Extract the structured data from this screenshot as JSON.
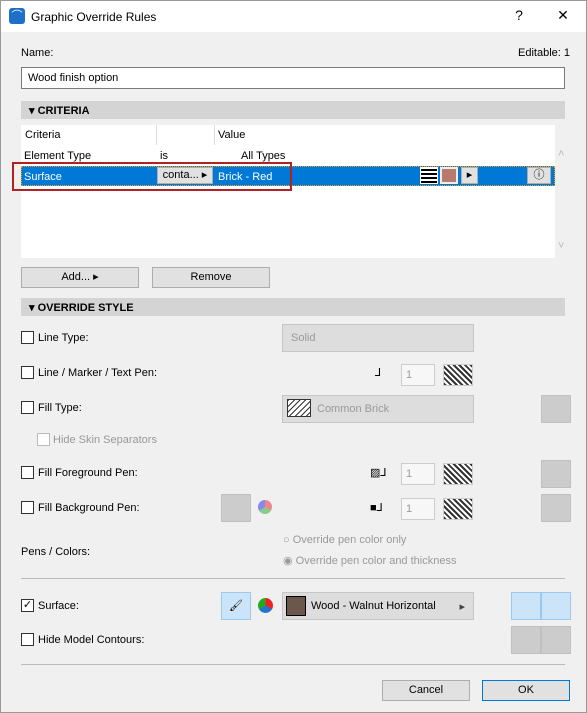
{
  "window": {
    "title": "Graphic Override Rules",
    "help": "?",
    "close": "✕"
  },
  "name": {
    "label": "Name:",
    "value": "Wood finish option",
    "editable": "Editable: 1"
  },
  "criteria": {
    "header": "CRITERIA",
    "columns": [
      "Criteria",
      "",
      "Value"
    ],
    "rows": [
      {
        "criteria": "Element Type",
        "op": "is",
        "value": "All Types"
      },
      {
        "criteria": "Surface",
        "op": "conta...",
        "value": "Brick - Red",
        "swatch": "#b87a6e"
      }
    ],
    "add": "Add...",
    "remove": "Remove"
  },
  "override": {
    "header": "OVERRIDE STYLE",
    "line_type": {
      "label": "Line Type:",
      "value": "Solid"
    },
    "line_pen": {
      "label": "Line / Marker / Text Pen:",
      "value": "1"
    },
    "fill_type": {
      "label": "Fill Type:",
      "value": "Common Brick"
    },
    "hide_skin": {
      "label": "Hide Skin Separators"
    },
    "fill_fg": {
      "label": "Fill Foreground Pen:",
      "value": "1"
    },
    "fill_bg": {
      "label": "Fill Background Pen:",
      "value": "1"
    },
    "pens_colors": {
      "label": "Pens / Colors:",
      "options": [
        "Override pen color only",
        "Override pen color and thickness"
      ]
    },
    "surface": {
      "label": "Surface:",
      "checked": true,
      "value": "Wood - Walnut Horizontal",
      "swatch": "#6b574b"
    },
    "hide_contours": {
      "label": "Hide Model Contours:"
    }
  },
  "footer": {
    "cancel": "Cancel",
    "ok": "OK"
  }
}
